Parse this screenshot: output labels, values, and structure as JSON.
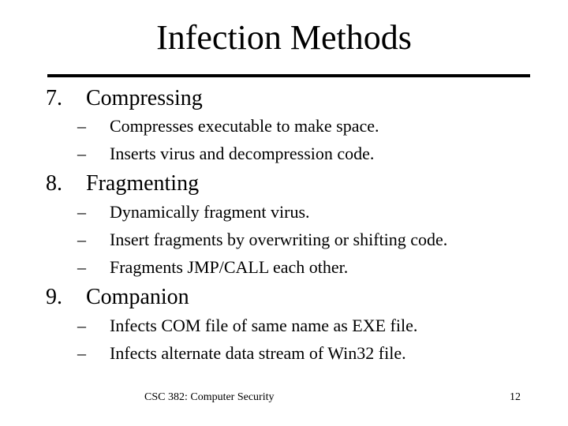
{
  "slide": {
    "title": "Infection Methods",
    "items": [
      {
        "number": "7.",
        "label": "Compressing",
        "subitems": [
          {
            "bullet": "–",
            "text": "Compresses executable to make space."
          },
          {
            "bullet": "–",
            "text": "Inserts virus and decompression code."
          }
        ]
      },
      {
        "number": "8.",
        "label": "Fragmenting",
        "subitems": [
          {
            "bullet": "–",
            "text": "Dynamically fragment virus."
          },
          {
            "bullet": "–",
            "text": "Insert fragments by overwriting or shifting code."
          },
          {
            "bullet": "–",
            "text": "Fragments JMP/CALL each other."
          }
        ]
      },
      {
        "number": "9.",
        "label": "Companion",
        "subitems": [
          {
            "bullet": "–",
            "text": "Infects COM file of same name as EXE file."
          },
          {
            "bullet": "–",
            "text": "Infects alternate data stream of Win32 file."
          }
        ]
      }
    ]
  },
  "footer": {
    "course": "CSC 382: Computer Security",
    "page_number": "12"
  }
}
